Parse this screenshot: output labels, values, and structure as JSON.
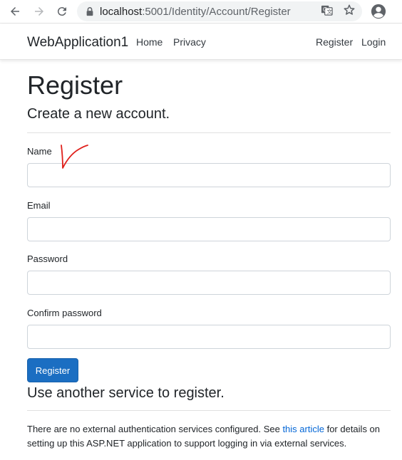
{
  "browser": {
    "url_host": "localhost",
    "url_rest": ":5001/Identity/Account/Register",
    "icons": [
      "back-arrow-icon",
      "forward-arrow-icon",
      "reload-icon",
      "lock-icon",
      "translate-icon",
      "star-icon",
      "profile-icon"
    ]
  },
  "navbar": {
    "brand": "WebApplication1",
    "links": [
      "Home",
      "Privacy"
    ],
    "right_links": [
      "Register",
      "Login"
    ]
  },
  "page": {
    "title": "Register",
    "subtitle": "Create a new account."
  },
  "form": {
    "fields": [
      {
        "label": "Name",
        "value": ""
      },
      {
        "label": "Email",
        "value": ""
      },
      {
        "label": "Password",
        "value": ""
      },
      {
        "label": "Confirm password",
        "value": ""
      }
    ],
    "submit_label": "Register"
  },
  "external": {
    "title": "Use another service to register.",
    "text_before": "There are no external authentication services configured. See ",
    "link_text": "this article",
    "text_after": " for details on setting up this ASP.NET application to support logging in via external services."
  },
  "annotation_color": "#e0201b"
}
